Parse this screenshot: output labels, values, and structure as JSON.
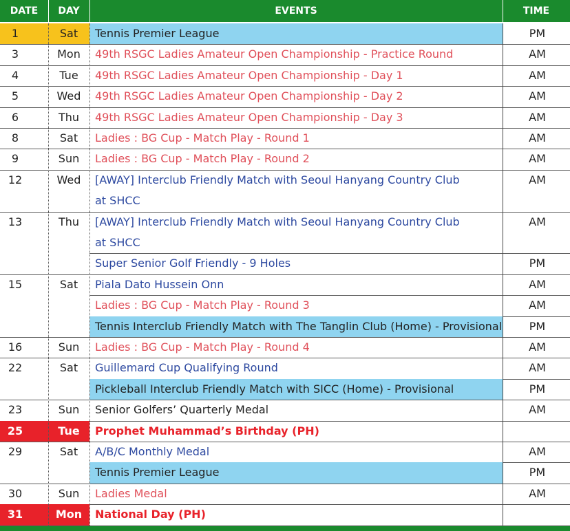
{
  "header": {
    "date": "DATE",
    "day": "DAY",
    "events": "EVENTS",
    "time": "TIME"
  },
  "colors": {
    "header_green": "#1a8a2d",
    "highlight_blue": "#8fd4f0",
    "highlight_yellow": "#f7c21c",
    "holiday_red": "#e8222a",
    "event_red": "#e0505a",
    "event_blue": "#2d49a0"
  },
  "rows": [
    {
      "date": "1",
      "day": "Sat",
      "events": [
        {
          "text": "Tennis Premier League",
          "time": "PM",
          "style": "black",
          "bg": "blue"
        }
      ],
      "date_bg": "yellow"
    },
    {
      "date": "3",
      "day": "Mon",
      "events": [
        {
          "text": "49th RSGC Ladies Amateur Open Championship - Practice Round",
          "time": "AM",
          "style": "red"
        }
      ]
    },
    {
      "date": "4",
      "day": "Tue",
      "events": [
        {
          "text": "49th RSGC Ladies Amateur Open Championship - Day 1",
          "time": "AM",
          "style": "red"
        }
      ]
    },
    {
      "date": "5",
      "day": "Wed",
      "events": [
        {
          "text": "49th RSGC Ladies Amateur Open Championship - Day 2",
          "time": "AM",
          "style": "red"
        }
      ]
    },
    {
      "date": "6",
      "day": "Thu",
      "events": [
        {
          "text": "49th RSGC Ladies Amateur Open Championship - Day 3",
          "time": "AM",
          "style": "red"
        }
      ]
    },
    {
      "date": "8",
      "day": "Sat",
      "events": [
        {
          "text": "Ladies : BG Cup - Match Play - Round 1",
          "time": "AM",
          "style": "red"
        }
      ]
    },
    {
      "date": "9",
      "day": "Sun",
      "events": [
        {
          "text": "Ladies : BG Cup - Match Play - Round 2",
          "time": "AM",
          "style": "red"
        }
      ]
    },
    {
      "date": "12",
      "day": "Wed",
      "events": [
        {
          "text": "[AWAY] Interclub Friendly Match with Seoul Hanyang Country Club",
          "text2": "at SHCC",
          "time": "AM",
          "style": "blue"
        }
      ]
    },
    {
      "date": "13",
      "day": "Thu",
      "events": [
        {
          "text": "[AWAY] Interclub Friendly Match with Seoul Hanyang Country Club",
          "text2": "at SHCC",
          "time": "AM",
          "style": "blue"
        },
        {
          "text": "Super Senior Golf Friendly - 9 Holes",
          "time": "PM",
          "style": "blue"
        }
      ]
    },
    {
      "date": "15",
      "day": "Sat",
      "events": [
        {
          "text": "Piala Dato Hussein Onn",
          "time": "AM",
          "style": "blue"
        },
        {
          "text": "Ladies : BG Cup - Match Play - Round 3",
          "time": "AM",
          "style": "red"
        },
        {
          "text": "Tennis Interclub Friendly Match with The Tanglin Club (Home) - Provisional",
          "time": "PM",
          "style": "black",
          "bg": "blue"
        }
      ]
    },
    {
      "date": "16",
      "day": "Sun",
      "events": [
        {
          "text": "Ladies : BG Cup - Match Play - Round 4",
          "time": "AM",
          "style": "red"
        }
      ]
    },
    {
      "date": "22",
      "day": "Sat",
      "events": [
        {
          "text": "Guillemard Cup Qualifying Round",
          "time": "AM",
          "style": "blue"
        },
        {
          "text": "Pickleball Interclub Friendly Match with SICC (Home) - Provisional",
          "time": "PM",
          "style": "black",
          "bg": "blue"
        }
      ]
    },
    {
      "date": "23",
      "day": "Sun",
      "events": [
        {
          "text": "Senior Golfers’ Quarterly Medal",
          "time": "AM",
          "style": "black"
        }
      ]
    },
    {
      "date": "25",
      "day": "Tue",
      "holiday": true,
      "events": [
        {
          "text": "Prophet Muhammad’s Birthday (PH)",
          "time": "",
          "style": "bold-red"
        }
      ]
    },
    {
      "date": "29",
      "day": "Sat",
      "events": [
        {
          "text": "A/B/C Monthly Medal",
          "time": "AM",
          "style": "blue"
        },
        {
          "text": "Tennis Premier League",
          "time": "PM",
          "style": "black",
          "bg": "blue"
        }
      ]
    },
    {
      "date": "30",
      "day": "Sun",
      "events": [
        {
          "text": "Ladies Medal",
          "time": "AM",
          "style": "red"
        }
      ]
    },
    {
      "date": "31",
      "day": "Mon",
      "holiday": true,
      "events": [
        {
          "text": "National Day (PH)",
          "time": "",
          "style": "bold-red"
        }
      ]
    }
  ]
}
